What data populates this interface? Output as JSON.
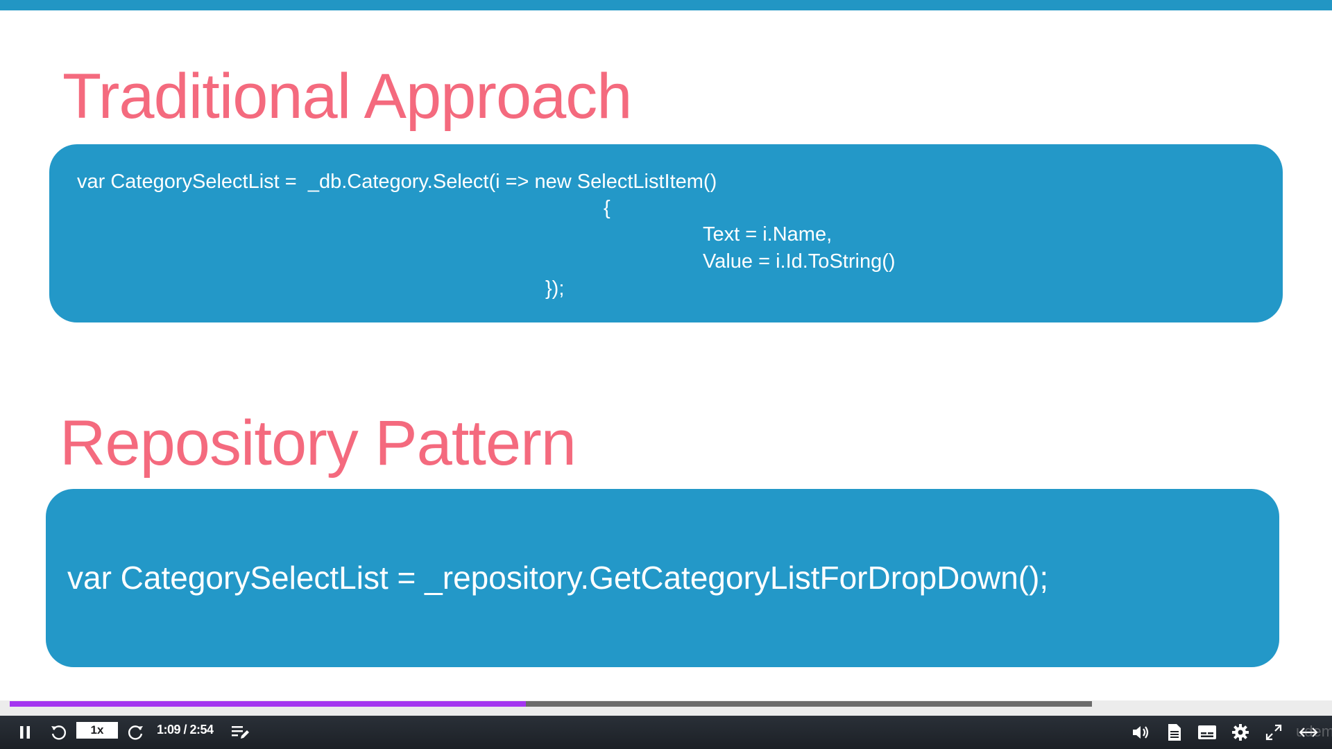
{
  "slide": {
    "heading_1": "Traditional Approach",
    "code_block_1": [
      "var CategorySelectList =  _db.Category.Select(i => new SelectListItem()",
      "{",
      "Text = i.Name,",
      "Value = i.Id.ToString()",
      "});"
    ],
    "heading_2": "Repository Pattern",
    "code_block_2": "var CategorySelectList = _repository.GetCategoryListForDropDown();"
  },
  "player": {
    "speed": "1x",
    "time": "1:09 / 2:54",
    "progress_fraction": 0.477,
    "watermark": "udemy"
  },
  "colors": {
    "accent_bar": "#2296c4",
    "heading": "#f46a7e",
    "code_box": "#2398c8",
    "progress": "#a435f0"
  },
  "icons": [
    "pause-icon",
    "rewind-icon",
    "forward-icon",
    "notes-icon",
    "volume-icon",
    "transcript-icon",
    "captions-icon",
    "settings-icon",
    "fullscreen-icon",
    "expand-icon"
  ]
}
